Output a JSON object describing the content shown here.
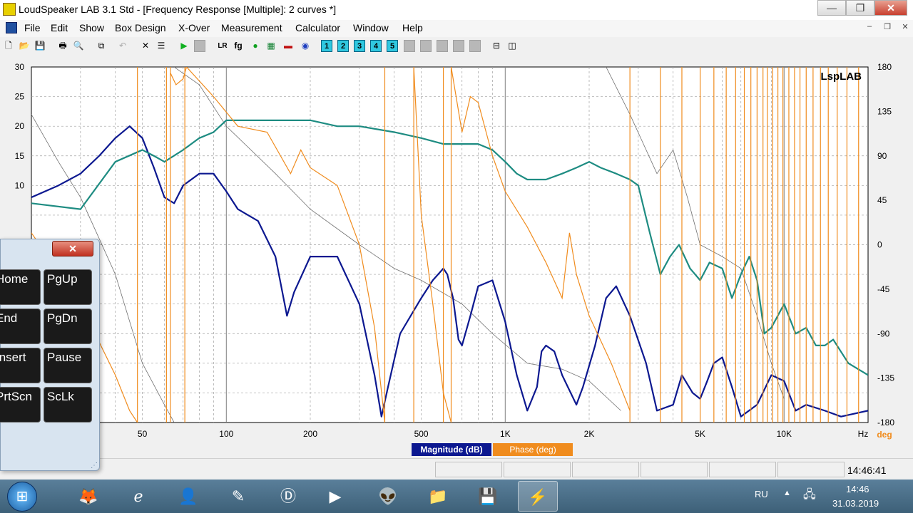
{
  "window": {
    "title": "LoudSpeaker LAB 3.1 Std - [Frequency Response [Multiple]: 2 curves *]",
    "controls": {
      "minimize": "—",
      "maximize": "❐",
      "close": "✕"
    }
  },
  "menubar": {
    "items": [
      "File",
      "Edit",
      "Show",
      "Box Design",
      "X-Over",
      "Measurement",
      "Calculator",
      "Window",
      "Help"
    ],
    "mdi_controls": {
      "minimize": "–",
      "restore": "❐",
      "close": "✕"
    }
  },
  "toolbar": {
    "numbered": [
      "1",
      "2",
      "3",
      "4",
      "5"
    ],
    "fg_label": "fg"
  },
  "chart_data": {
    "type": "line",
    "watermark": "LspLAB",
    "x_scale": "log",
    "xlim": [
      20,
      20000
    ],
    "x_ticks": [
      {
        "value": 50,
        "label": "50"
      },
      {
        "value": 100,
        "label": "100"
      },
      {
        "value": 200,
        "label": "200"
      },
      {
        "value": 500,
        "label": "500"
      },
      {
        "value": 1000,
        "label": "1K"
      },
      {
        "value": 2000,
        "label": "2K"
      },
      {
        "value": 5000,
        "label": "5K"
      },
      {
        "value": 10000,
        "label": "10K"
      }
    ],
    "x_unit": "Hz",
    "y_left": {
      "ylim": [
        -30,
        30
      ],
      "ticks": [
        "30",
        "25",
        "20",
        "15",
        "10"
      ]
    },
    "y_right": {
      "ylim": [
        -180,
        180
      ],
      "ticks": [
        "180",
        "135",
        "90",
        "45",
        "0",
        "-45",
        "-90",
        "-135",
        "-180"
      ],
      "unit": "deg"
    },
    "grid": true,
    "legend": [
      {
        "name": "Magnitude (dB)",
        "color": "#0c1890"
      },
      {
        "name": "Phase (deg)",
        "color": "#f08c1e"
      }
    ],
    "series": [
      {
        "name": "Magnitude (dB)",
        "color": "#0c1890",
        "axis": "left",
        "x": [
          20,
          25,
          30,
          35,
          40,
          45,
          50,
          55,
          60,
          65,
          70,
          80,
          90,
          100,
          110,
          130,
          150,
          165,
          175,
          200,
          250,
          300,
          340,
          360,
          380,
          420,
          500,
          550,
          600,
          620,
          650,
          680,
          700,
          750,
          800,
          900,
          1000,
          1100,
          1200,
          1300,
          1350,
          1400,
          1500,
          1600,
          1800,
          1900,
          2100,
          2300,
          2500,
          2800,
          3200,
          3500,
          4000,
          4300,
          4700,
          5000,
          5300,
          5600,
          6000,
          6500,
          7000,
          8000,
          9000,
          10000,
          11000,
          12000,
          14000,
          16000,
          20000
        ],
        "y": [
          8,
          10,
          12,
          15,
          18,
          20,
          18,
          13,
          8,
          7,
          10,
          12,
          12,
          9,
          6,
          4,
          -2,
          -12,
          -8,
          -2,
          -2,
          -10,
          -22,
          -29,
          -24,
          -15,
          -9,
          -6,
          -4,
          -5,
          -9,
          -16,
          -17,
          -12,
          -7,
          -6,
          -13,
          -22,
          -28,
          -24,
          -18,
          -17,
          -18,
          -22,
          -27,
          -24,
          -17,
          -9,
          -7,
          -12,
          -20,
          -28,
          -27,
          -22,
          -25,
          -26,
          -23,
          -20,
          -19,
          -24,
          -29,
          -27,
          -22,
          -23,
          -28,
          -27,
          -28,
          -29,
          -28
        ]
      },
      {
        "name": "Magnitude (dB)",
        "color": "#1e8c82",
        "axis": "left",
        "x": [
          20,
          30,
          40,
          50,
          55,
          60,
          70,
          80,
          90,
          100,
          110,
          130,
          150,
          170,
          200,
          250,
          300,
          400,
          500,
          600,
          650,
          700,
          800,
          900,
          1000,
          1100,
          1200,
          1400,
          1600,
          1800,
          2000,
          2200,
          2500,
          2800,
          3000,
          3300,
          3600,
          3900,
          4200,
          4600,
          5000,
          5400,
          6000,
          6500,
          7000,
          7500,
          8000,
          8500,
          9000,
          10000,
          11000,
          12000,
          13000,
          14000,
          15000,
          17000,
          20000
        ],
        "y": [
          7,
          6,
          14,
          16,
          15,
          14,
          16,
          18,
          19,
          21,
          21,
          21,
          21,
          21,
          21,
          20,
          20,
          19,
          18,
          17,
          17,
          17,
          17,
          16,
          14,
          12,
          11,
          11,
          12,
          13,
          14,
          13,
          12,
          11,
          10,
          2,
          -5,
          -2,
          0,
          -4,
          -6,
          -3,
          -4,
          -9,
          -5,
          -2,
          -6,
          -15,
          -14,
          -10,
          -15,
          -14,
          -17,
          -17,
          -16,
          -20,
          -22
        ]
      }
    ]
  },
  "osk": {
    "close_label": "✕",
    "keys": [
      {
        "label": "Home",
        "side": "left"
      },
      {
        "label": "PgUp",
        "side": "right"
      },
      {
        "label": "End",
        "side": "left"
      },
      {
        "label": "PgDn",
        "side": "right"
      },
      {
        "label": "Insert",
        "side": "left"
      },
      {
        "label": "Pause",
        "side": "right"
      },
      {
        "label": "PrtScn",
        "side": "left"
      },
      {
        "label": "ScLk",
        "side": "right"
      }
    ]
  },
  "statusbar": {
    "time": "14:46:41"
  },
  "taskbar": {
    "language": "RU",
    "clock_time": "14:46",
    "clock_date": "31.03.2019"
  }
}
